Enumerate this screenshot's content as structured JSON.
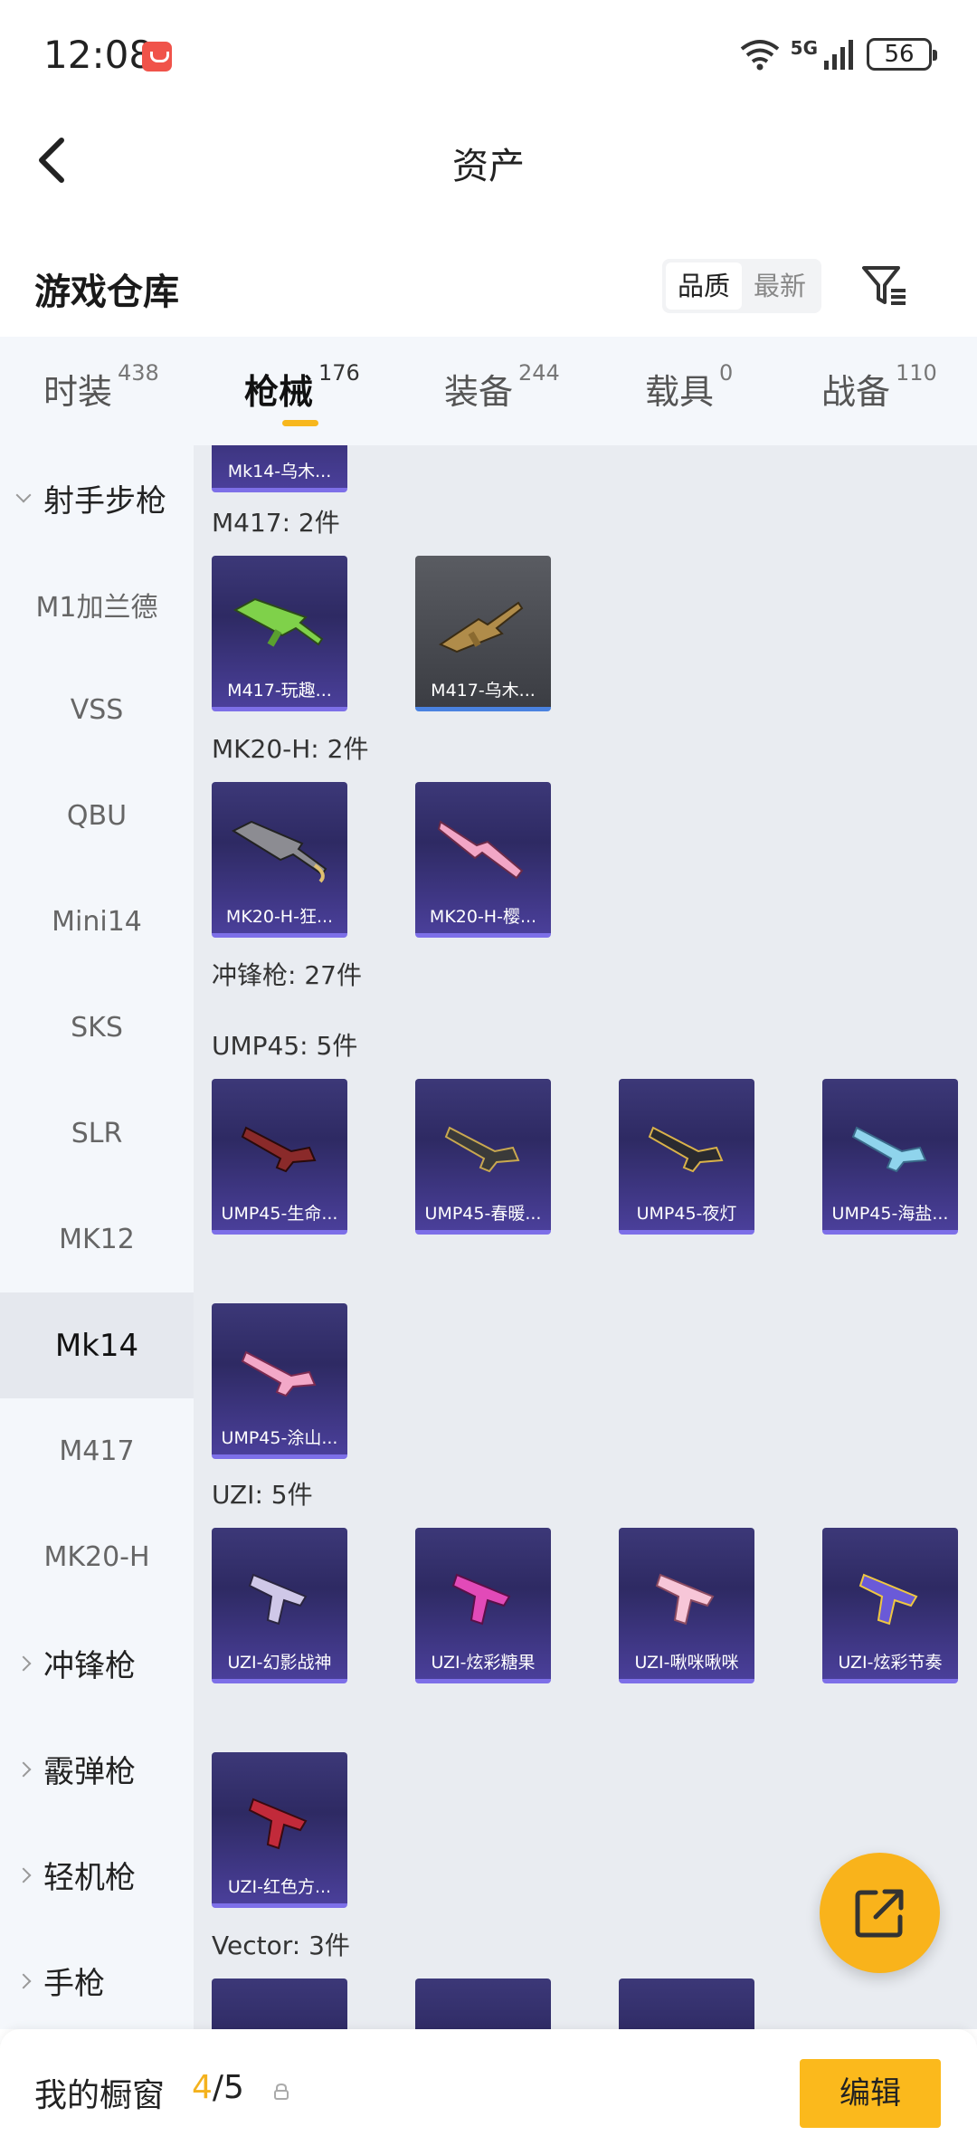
{
  "status_bar": {
    "time": "12:08",
    "battery": "56",
    "network": "5G"
  },
  "nav": {
    "title": "资产"
  },
  "warehouse": {
    "title": "游戏仓库",
    "sort_options": [
      "品质",
      "最新"
    ]
  },
  "tabs": [
    {
      "label": "时装",
      "count": "438"
    },
    {
      "label": "枪械",
      "count": "176"
    },
    {
      "label": "装备",
      "count": "244"
    },
    {
      "label": "载具",
      "count": "0"
    },
    {
      "label": "战备",
      "count": "110"
    }
  ],
  "sidebar": {
    "items": [
      {
        "label": "射手步枪",
        "type": "group",
        "expanded": true
      },
      {
        "label": "M1加兰德"
      },
      {
        "label": "VSS"
      },
      {
        "label": "QBU"
      },
      {
        "label": "Mini14"
      },
      {
        "label": "SKS"
      },
      {
        "label": "SLR"
      },
      {
        "label": "MK12"
      },
      {
        "label": "Mk14",
        "active": true
      },
      {
        "label": "M417"
      },
      {
        "label": "MK20-H"
      },
      {
        "label": "冲锋枪",
        "type": "group"
      },
      {
        "label": "霰弹枪",
        "type": "group"
      },
      {
        "label": "轻机枪",
        "type": "group"
      },
      {
        "label": "手枪",
        "type": "group"
      }
    ]
  },
  "sections": {
    "mk14_partial": {
      "items": [
        "Mk14-乌木..."
      ]
    },
    "m417": {
      "label": "M417: 2件",
      "items": [
        "M417-玩趣...",
        "M417-乌木..."
      ]
    },
    "mk20h": {
      "label": "MK20-H: 2件",
      "items": [
        "MK20-H-狂...",
        "MK20-H-樱..."
      ]
    },
    "smg": {
      "label": "冲锋枪: 27件"
    },
    "ump45": {
      "label": "UMP45: 5件",
      "items": [
        "UMP45-生命...",
        "UMP45-春暖...",
        "UMP45-夜灯",
        "UMP45-海盐...",
        "UMP45-涂山..."
      ]
    },
    "uzi": {
      "label": "UZI: 5件",
      "items": [
        "UZI-幻影战神",
        "UZI-炫彩糖果",
        "UZI-啾咪啾咪",
        "UZI-炫彩节奏",
        "UZI-红色方..."
      ]
    },
    "vector": {
      "label": "Vector: 3件"
    }
  },
  "bottom_bar": {
    "label": "我的橱窗",
    "current": "4",
    "total": "/5",
    "edit_label": "编辑"
  },
  "colors": {
    "accent": "#f9b31b",
    "card_purple": "#3c3878",
    "card_grey": "#55575d"
  }
}
